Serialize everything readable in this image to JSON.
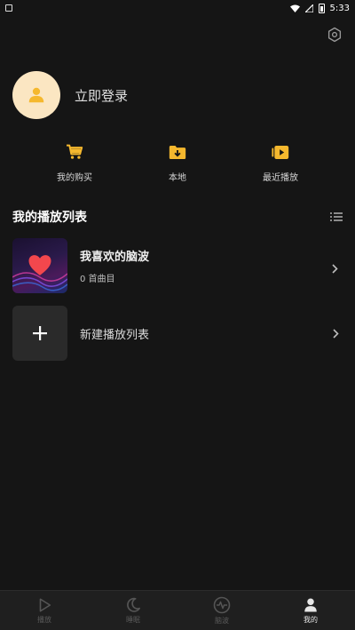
{
  "status_bar": {
    "time": "5:33"
  },
  "profile": {
    "login_label": "立即登录"
  },
  "quick_actions": [
    {
      "label": "我的购买",
      "icon": "cart-icon"
    },
    {
      "label": "本地",
      "icon": "folder-download-icon"
    },
    {
      "label": "最近播放",
      "icon": "recent-play-icon"
    }
  ],
  "playlists": {
    "title": "我的播放列表",
    "favorite": {
      "name": "我喜欢的脑波",
      "count": "0 首曲目"
    },
    "create": {
      "name": "新建播放列表"
    }
  },
  "tabs": [
    {
      "label": "播放",
      "icon": "play-icon",
      "active": false
    },
    {
      "label": "睡眠",
      "icon": "moon-icon",
      "active": false
    },
    {
      "label": "脑波",
      "icon": "brainwave-icon",
      "active": false
    },
    {
      "label": "我的",
      "icon": "person-icon",
      "active": true
    }
  ],
  "colors": {
    "accent": "#f5b82e",
    "background": "#151515",
    "avatar_bg": "#fbe6c2",
    "tabbar_bg": "#1f1f1f"
  }
}
